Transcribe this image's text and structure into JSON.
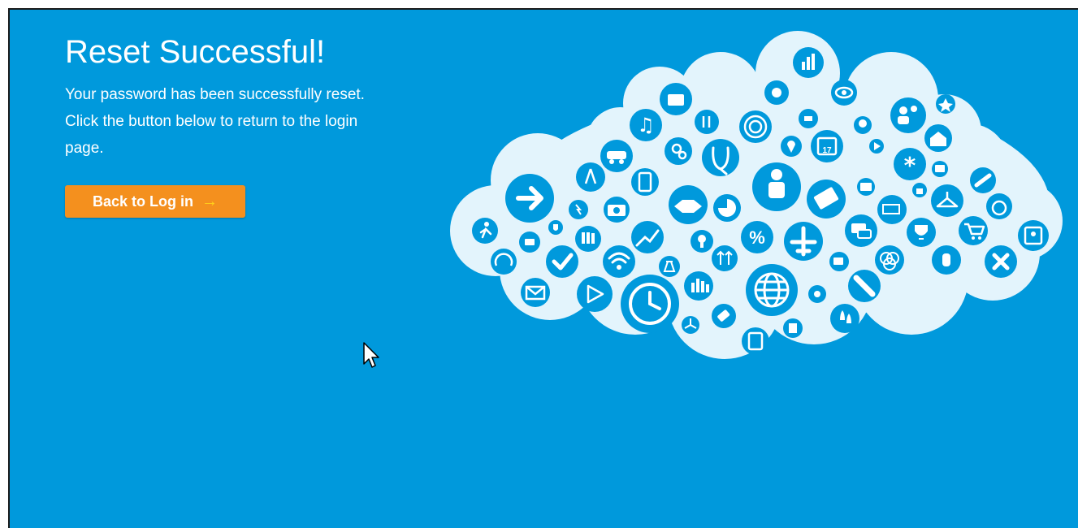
{
  "page": {
    "title": "Reset Successful!",
    "message": "Your password has been successfully reset. Click the button below to return to the login page.",
    "back_button_label": "Back to Log in",
    "back_button_icon": "arrow-right-icon"
  },
  "colors": {
    "background": "#0099dc",
    "cloud": "#e3f4fc",
    "icon_circle": "#0099dc",
    "button": "#f4901e",
    "button_arrow": "#ffd21a"
  },
  "cloud_icons": [
    "arrow-right-icon",
    "runner-icon",
    "gauge-icon",
    "envelope-icon",
    "card-icon",
    "checkmark-icon",
    "compass-icon",
    "lightning-icon",
    "play-icon",
    "shield-icon",
    "books-icon",
    "wifi-icon",
    "music-icon",
    "car-icon",
    "camera-icon",
    "phone-icon",
    "chart-up-icon",
    "clock-icon",
    "briefcase-icon",
    "tools-icon",
    "gears-icon",
    "handshake-icon",
    "keyhole-icon",
    "flask-icon",
    "arrows-up-icon",
    "equalizer-icon",
    "windmill-icon",
    "tag-icon",
    "stethoscope-icon",
    "pie-chart-icon",
    "target-icon",
    "person-icon",
    "percent-icon",
    "globe-icon",
    "tablet-icon",
    "bar-chart-icon",
    "puzzle-icon",
    "eye-icon",
    "org-chart-icon",
    "map-pin-icon",
    "calendar-icon",
    "airplane-icon",
    "sun-icon",
    "document-icon",
    "drops-icon",
    "bulb-icon",
    "money-icon",
    "chat-icon",
    "coffee-icon",
    "flashlight-icon",
    "medkit-icon",
    "battery-icon",
    "lock-icon",
    "people-icon",
    "asterisk-icon",
    "venn-icon",
    "star-icon",
    "garage-icon",
    "folder-icon",
    "hanger-icon",
    "trophy-icon",
    "link-icon",
    "stopwatch-icon",
    "cart-icon",
    "touch-icon",
    "close-icon",
    "contact-card-icon"
  ],
  "calendar_day": "17"
}
